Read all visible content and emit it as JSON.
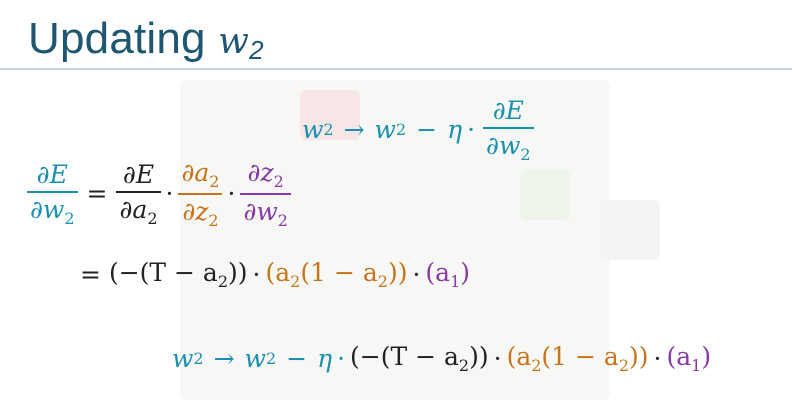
{
  "title": {
    "text": "Updating ",
    "var": "w",
    "sub": "2"
  },
  "colors": {
    "title": "#1f5672",
    "blue": "#1a8fb0",
    "orange": "#c8741a",
    "purple": "#8a3aa8"
  },
  "equations": {
    "update_rule": {
      "lhs_var": "w",
      "lhs_sub": "2",
      "arrow": "→",
      "rhs_var": "w",
      "rhs_sub": "2",
      "minus": "−",
      "eta": "η",
      "dot": "·",
      "frac_num": "∂E",
      "frac_den_var": "∂w",
      "frac_den_sub": "2"
    },
    "chain_rule": {
      "lhs_num": "∂E",
      "lhs_den": "∂w",
      "lhs_den_sub": "2",
      "equals": "=",
      "t1_num": "∂E",
      "t1_den": "∂a",
      "t1_den_sub": "2",
      "t2_num": "∂a",
      "t2_num_sub": "2",
      "t2_den": "∂z",
      "t2_den_sub": "2",
      "t3_num": "∂z",
      "t3_num_sub": "2",
      "t3_den": "∂w",
      "t3_den_sub": "2",
      "dot": "·"
    },
    "expanded": {
      "equals": "=",
      "term1_open": "(−(T − a",
      "term1_sub": "2",
      "term1_close": "))",
      "term2_open": "(a",
      "term2_sub1": "2",
      "term2_mid": "(1 − a",
      "term2_sub2": "2",
      "term2_close": "))",
      "term3_open": "(a",
      "term3_sub": "1",
      "term3_close": ")",
      "dot": "·"
    },
    "final": {
      "lhs_var": "w",
      "lhs_sub": "2",
      "arrow": "→",
      "rhs_var": "w",
      "rhs_sub": "2",
      "minus": "−",
      "eta": "η",
      "dot": "·",
      "term1_open": "(−(T − a",
      "term1_sub": "2",
      "term1_close": "))",
      "term2_open": "(a",
      "term2_sub1": "2",
      "term2_mid": "(1 − a",
      "term2_sub2": "2",
      "term2_close": "))",
      "term3_open": "(a",
      "term3_sub": "1",
      "term3_close": ")"
    }
  }
}
